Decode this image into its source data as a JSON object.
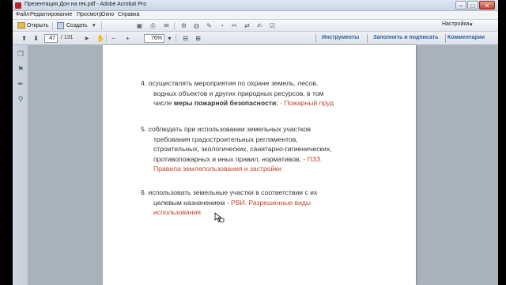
{
  "window": {
    "title": "Презентация Дон на гек.pdf - Adobe Acrobat Pro",
    "min_glyph": "–",
    "max_glyph": "□",
    "close_glyph": "✕"
  },
  "menu": [
    "Файл",
    "Редактирование",
    "Просмотр",
    "Окно",
    "Справка"
  ],
  "toolbar": {
    "open_label": "Открыть",
    "create_label": "Создать",
    "create_arrow": "▾",
    "setup_label": "Настройка",
    "setup_arrow": "▾"
  },
  "nav": {
    "current_page": "47",
    "total_pages": "/ 131",
    "zoom": "76%",
    "zoom_arrow": "▾",
    "minus": "−",
    "plus": "+"
  },
  "tabs": {
    "tools": "Инструменты",
    "fill_sign": "Заполнить и подписать",
    "comments": "Комментарии"
  },
  "document": {
    "items": [
      {
        "num": "4.",
        "lines": [
          "осуществлять мероприятия по охране земель, лесов,",
          "водных объектов и других природных ресурсов, в том"
        ],
        "last_prefix": "числе",
        "last_bold": "меры пожарной безопасности",
        "last_plain": ";  ",
        "last_red": "- Пожарный пруд"
      },
      {
        "num": "5.",
        "first": "соблюдать при использовании земельных участков",
        "lines": [
          "требования градостроительных регламентов,",
          "строительных, экологических, санитарно-гигиенических,"
        ],
        "line4_plain": "противопожарных и иных правил, нормативов;  ",
        "line4_red": "- ПЗЗ.",
        "line5_red": "Правила землепользования и застройки"
      },
      {
        "num": "6.",
        "first": "использовать земельные участки в соответствии с их",
        "line2_plain": "целевым назначением  -  ",
        "line2_red": "РВИ. Разрешенные виды",
        "line3_red": "использования"
      }
    ]
  }
}
